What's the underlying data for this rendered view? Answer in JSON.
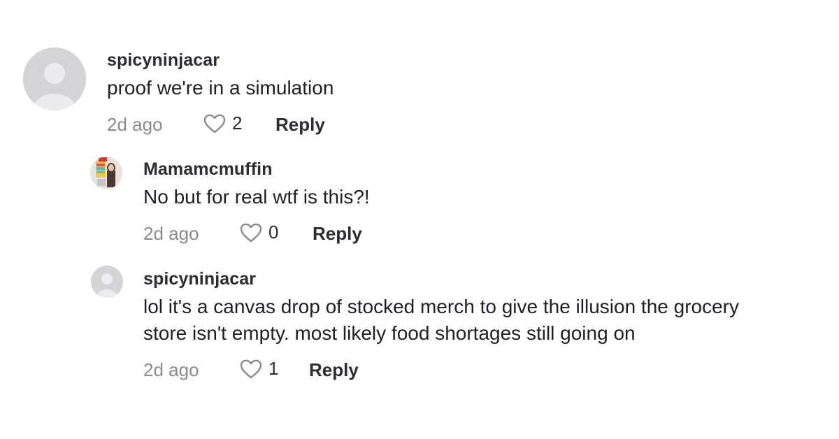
{
  "comments": [
    {
      "username": "spicyninjacar",
      "text": [
        "proof we're in a simulation"
      ],
      "time": "2d ago",
      "likes": "2",
      "reply_label": "Reply",
      "avatar": "default-avatar-icon"
    },
    {
      "username": "Mamamcmuffin",
      "text": [
        "No but for real wtf is this?!"
      ],
      "time": "2d ago",
      "likes": "0",
      "reply_label": "Reply",
      "avatar": "user-photo"
    },
    {
      "username": "spicyninjacar",
      "text": [
        "lol it's a canvas drop of stocked merch to give the illusion the grocery",
        "store isn't empty. most likely food shortages still going on"
      ],
      "time": "2d ago",
      "likes": "1",
      "reply_label": "Reply",
      "avatar": "default-avatar-icon"
    }
  ],
  "colors": {
    "text_primary": "#1f1f26",
    "text_secondary": "#8a8b91",
    "avatar_bg": "#d6d6d6"
  }
}
